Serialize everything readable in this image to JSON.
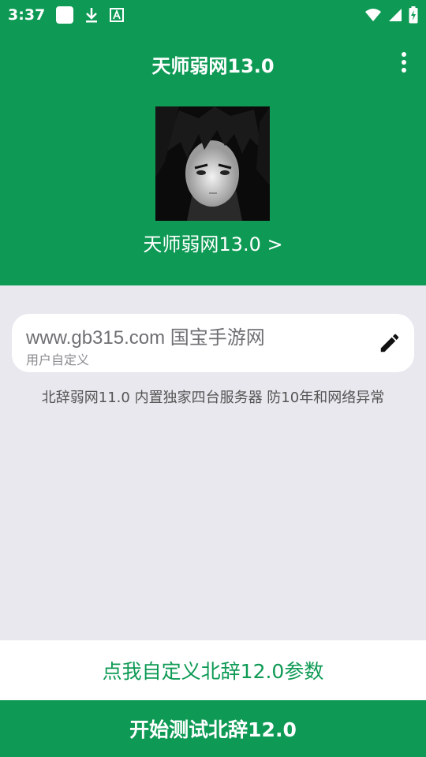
{
  "status_bar": {
    "time": "3:37",
    "icons": [
      "app-notification-icon",
      "download-icon",
      "text-a-icon",
      "wifi-icon",
      "signal-icon",
      "battery-charging-icon"
    ]
  },
  "app_bar": {
    "title": "天师弱网13.0",
    "menu_icon": "more-vert-icon"
  },
  "profile": {
    "name": "天师弱网13.0 >"
  },
  "input": {
    "value": "www.gb315.com 国宝手游网",
    "hint": "用户自定义",
    "edit_icon": "edit-pencil-icon"
  },
  "info": {
    "text": "北辞弱网11.0 内置独家四台服务器 防10年和网络异常"
  },
  "buttons": {
    "customize": "点我自定义北辞12.0参数",
    "start": "开始测试北辞12.0"
  },
  "colors": {
    "primary": "#0e9a55",
    "background": "#e8e8ee"
  }
}
